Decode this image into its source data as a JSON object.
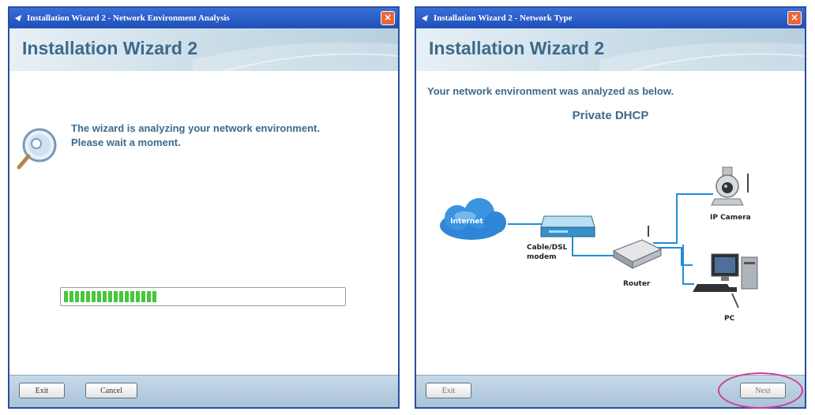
{
  "left_window": {
    "title": "Installation Wizard 2 - Network Environment Analysis",
    "header": "Installation Wizard 2",
    "message_line1": "The wizard is analyzing your network environment.",
    "message_line2": "Please wait a moment.",
    "progress_percent": 34,
    "buttons": {
      "exit": "Exit",
      "cancel": "Cancel"
    }
  },
  "right_window": {
    "title": "Installation Wizard 2 - Network Type",
    "header": "Installation Wizard 2",
    "analyzed_text": "Your network environment was analyzed as below.",
    "network_type": "Private DHCP",
    "diagram": {
      "internet": "Internet",
      "modem_line1": "Cable/DSL",
      "modem_line2": "modem",
      "router": "Router",
      "camera": "IP Camera",
      "pc": "PC"
    },
    "buttons": {
      "exit": "Exit",
      "next": "Next"
    }
  },
  "colors": {
    "titlebar": "#2a5cc8",
    "header_text": "#3d6a8a",
    "progress_green": "#46c83a",
    "highlight_circle": "#cc3d9b",
    "cable": "#1f8fd6"
  },
  "icons": [
    "app-icon",
    "close-icon",
    "magnifier-icon",
    "internet-cloud-icon",
    "modem-icon",
    "router-icon",
    "ip-camera-icon",
    "pc-icon"
  ]
}
